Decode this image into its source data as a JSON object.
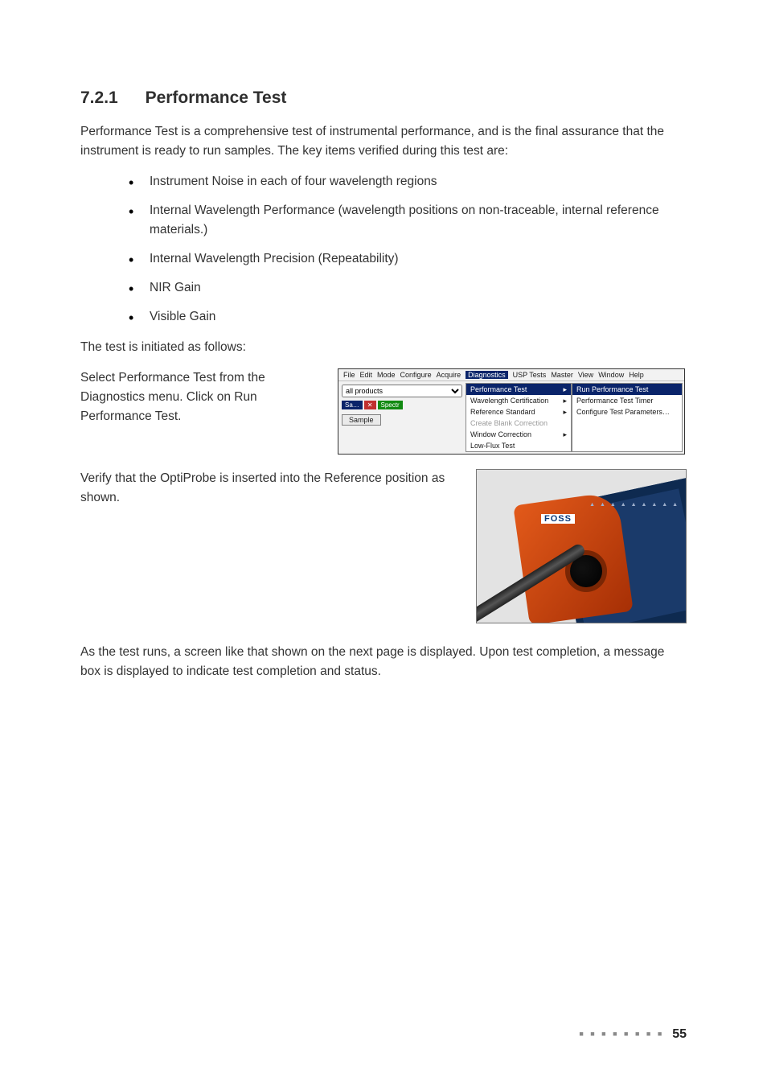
{
  "heading": {
    "number": "7.2.1",
    "title": "Performance Test"
  },
  "intro": "Performance Test is a comprehensive test of instrumental performance, and is the final assurance that the instrument is ready to run samples. The key items verified during this test are:",
  "bullets": {
    "b1": "Instrument Noise in each of four wavelength regions",
    "b2": "Internal Wavelength Performance (wavelength positions on non-traceable, internal reference materials.)",
    "b3": "Internal Wavelength Precision (Repeatability)",
    "b4": "NIR Gain",
    "b5": "Visible Gain"
  },
  "initiated": "The test is initiated as follows:",
  "step1": "Select Performance Test from the Diagnostics menu. Click on Run Performance Test.",
  "step2": "Verify that the OptiProbe is inserted into the Reference position as shown.",
  "closing": "As the test runs, a screen like that shown on the next page is displayed. Upon test completion, a message box is displayed to indicate test completion and status.",
  "menu": {
    "bar": {
      "file": "File",
      "edit": "Edit",
      "mode": "Mode",
      "configure": "Configure",
      "acquire": "Acquire",
      "diagnostics": "Diagnostics",
      "usp": "USP Tests",
      "master": "Master",
      "view": "View",
      "window": "Window",
      "help": "Help"
    },
    "select": {
      "value": "all products"
    },
    "docspectr": "Spectr",
    "docsa": "Sa…",
    "sampleBtn": "Sample",
    "dropdown": {
      "perf": "Performance Test",
      "wlcert": "Wavelength Certification",
      "refstd": "Reference Standard",
      "cblank": "Create Blank Correction",
      "wcorr": "Window Correction",
      "lowflux": "Low-Flux Test"
    },
    "sub": {
      "run": "Run Performance Test",
      "timer": "Performance Test Timer",
      "params": "Configure Test Parameters…"
    }
  },
  "photo": {
    "brand": "FOSS",
    "dots": "▲ ▲ ▲\n▲ ▲ ▲\n▲ ▲ ▲"
  },
  "pageNumber": "55",
  "footerBars": "■ ■ ■ ■ ■ ■ ■ ■"
}
